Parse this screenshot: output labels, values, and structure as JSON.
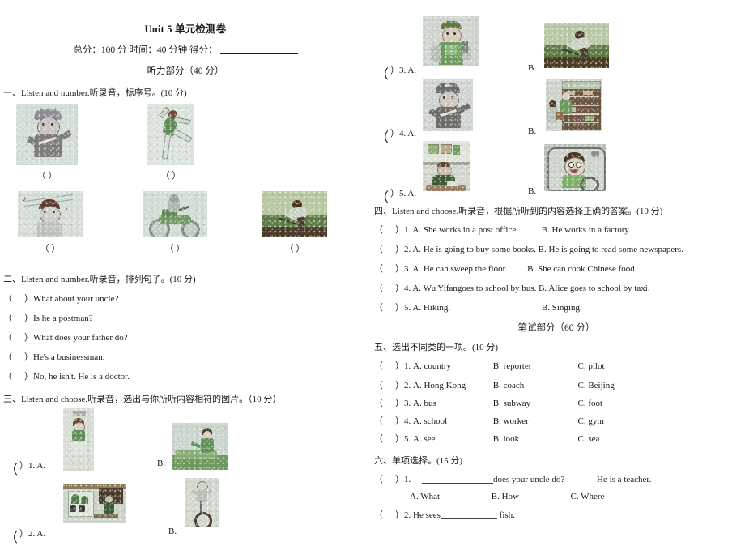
{
  "header": {
    "title": "Unit 5  单元检测卷",
    "score_line": "总分：100 分 时间：40 分钟   得分：",
    "listening_part": "听力部分（40 分）",
    "written_part": "笔试部分（60 分）"
  },
  "section1": {
    "heading": "一、Listen and number.听录音，标序号。(10 分)",
    "captions": [
      "（    ）",
      "（    ）",
      "（    ）",
      "（    ）",
      "（    ）"
    ],
    "images": [
      {
        "name": "policeman-pointing",
        "alt": "policeman in cap pointing"
      },
      {
        "name": "dancer-leaping",
        "alt": "dancer in green leotard leaping"
      },
      {
        "name": "boy-singing-notes",
        "alt": "boy singing with music notes"
      },
      {
        "name": "person-riding-motorcycle",
        "alt": "person riding a green motorbike"
      },
      {
        "name": "farmer-hoeing-field",
        "alt": "farmer working in a green field"
      }
    ]
  },
  "section2": {
    "heading": "二、Listen and number.听录音，排列句子。(10 分)",
    "items": [
      "）What about your uncle?",
      "）Is he a postman?",
      "）What does your father do?",
      "）He's a businessman.",
      "）No, he isn't. He is a doctor."
    ],
    "paren_open": "（"
  },
  "section3": {
    "heading": "三、Listen and choose.听录音，选出与你所听内容相符的图片。（10 分）",
    "questions": [
      {
        "num": "）1. A.",
        "b_label": "B.",
        "a_image": {
          "name": "girl-standing-thinking",
          "alt": "girl in green top standing"
        },
        "b_image": {
          "name": "woman-making-bed",
          "alt": "woman making a green bed"
        }
      },
      {
        "num": "）2. A.",
        "b_label": "B.",
        "a_image": {
          "name": "person-watering-plants-indoors",
          "alt": "person by window with plants"
        },
        "b_image": {
          "name": "person-riding-unicycle",
          "alt": "person riding a unicycle"
        }
      }
    ]
  },
  "section3_right": {
    "questions": [
      {
        "num": "）3. A.",
        "b_label": "B.",
        "a_image": {
          "name": "worker-with-tool",
          "alt": "worker in green overalls holding tool"
        },
        "b_image": {
          "name": "farmer-in-field",
          "alt": "farmer bending over in green field"
        }
      },
      {
        "num": "）4. A.",
        "b_label": "B.",
        "a_image": {
          "name": "policeman-saluting",
          "alt": "policeman in cap"
        },
        "b_image": {
          "name": "shopkeeper-at-shelves",
          "alt": "shopkeeper with customer at store shelves"
        }
      },
      {
        "num": "）5. A.",
        "b_label": "B.",
        "a_image": {
          "name": "man-at-desk-reading",
          "alt": "man seated at desk with papers"
        },
        "b_image": {
          "name": "boy-driving-car",
          "alt": "smiling boy driving a car"
        }
      }
    ]
  },
  "section4": {
    "heading": "四、Listen and choose.听录音，根据所听到的内容选择正确的答案。(10 分)",
    "rows": [
      {
        "num": "）1.",
        "a": "A. She works in a post office.",
        "b": "B. He works in a factory."
      },
      {
        "num": "）2.",
        "a": "A. He is going to buy some books.",
        "b": "B. He is going to    read some newspapers."
      },
      {
        "num": "）3.",
        "a": "A. He can sweep the floor.",
        "b": "B. She can cook Chinese food."
      },
      {
        "num": "）4.",
        "a": "A. Wu Yifangoes to school by bus.",
        "b": "B. Alice goes to school by taxi."
      },
      {
        "num": "）5.",
        "a": "A. Hiking.",
        "b": "B. Singing."
      }
    ]
  },
  "section5": {
    "heading": "五、选出不同类的一项。(10 分)",
    "rows": [
      {
        "num": "）1.",
        "a": "A. country",
        "b": "B. reporter",
        "c": "C. pilot"
      },
      {
        "num": "）2.",
        "a": "A. Hong Kong",
        "b": "B. coach",
        "c": "C. Beijing"
      },
      {
        "num": "）3.",
        "a": "A. bus",
        "b": "B. subway",
        "c": "C. foot"
      },
      {
        "num": "）4.",
        "a": "A. school",
        "b": "B. worker",
        "c": "C. gym"
      },
      {
        "num": "）5.",
        "a": "A. see",
        "b": "B. look",
        "c": "C. sea"
      }
    ]
  },
  "section6": {
    "heading": "六、单项选择。(15 分)",
    "q1": {
      "num": "）1.",
      "dash_before": "---",
      "after_blank": "does your uncle do?",
      "answer": "---He is a teacher.",
      "options": {
        "a": "A. What",
        "b": "B. How",
        "c": "C. Where"
      }
    },
    "q2": {
      "num": "）2.",
      "before_blank": "He sees",
      "after_blank": "fish."
    }
  }
}
